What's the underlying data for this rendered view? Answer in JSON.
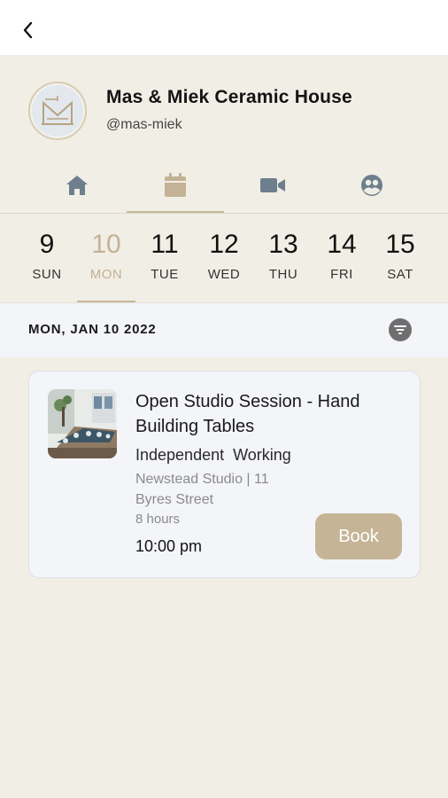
{
  "header": {
    "back_icon": "chevron-left-icon"
  },
  "profile": {
    "name": "Mas & Miek Ceramic House",
    "handle": "@mas-miek"
  },
  "tabs": [
    {
      "icon": "home-icon",
      "active": false
    },
    {
      "icon": "calendar-icon",
      "active": true
    },
    {
      "icon": "video-camera-icon",
      "active": false
    },
    {
      "icon": "group-icon",
      "active": false
    }
  ],
  "days": [
    {
      "num": "9",
      "name": "SUN"
    },
    {
      "num": "10",
      "name": "MON",
      "selected": true
    },
    {
      "num": "11",
      "name": "TUE"
    },
    {
      "num": "12",
      "name": "WED"
    },
    {
      "num": "13",
      "name": "THU"
    },
    {
      "num": "14",
      "name": "FRI"
    },
    {
      "num": "15",
      "name": "SAT"
    }
  ],
  "date_bar": {
    "label": "MON, JAN 10 2022",
    "filter_icon": "filter-icon"
  },
  "event": {
    "title": "Open Studio Session - Hand Building Tables",
    "type": "Independent  Working",
    "location": "Newstead Studio | 11 Byres Street",
    "duration": "8 hours",
    "time": "10:00 pm",
    "book_label": "Book"
  },
  "colors": {
    "accent": "#c5b596",
    "background": "#f1eee5",
    "card": "#f4f5f9"
  }
}
